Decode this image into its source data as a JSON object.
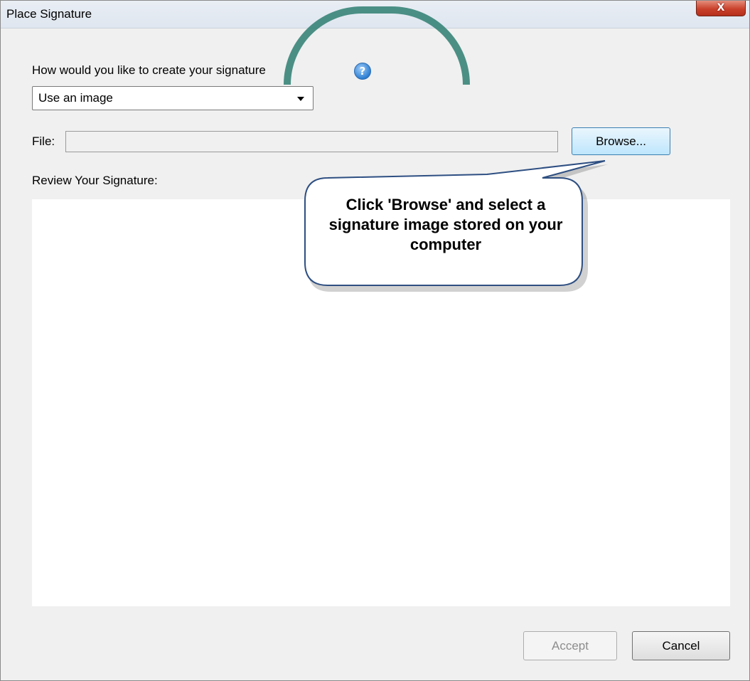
{
  "window": {
    "title": "Place Signature",
    "close_glyph": "X"
  },
  "form": {
    "method_label": "How would you like to create your signature",
    "help_glyph": "?",
    "method_value": "Use an image",
    "file_label": "File:",
    "file_value": "",
    "browse_label": "Browse...",
    "review_label": "Review Your Signature:"
  },
  "callout": {
    "text": "Click 'Browse' and select a signature image stored on your computer"
  },
  "footer": {
    "accept_label": "Accept",
    "cancel_label": "Cancel"
  },
  "colors": {
    "close_button": "#c9412b",
    "help_icon": "#2e7fd3",
    "callout_border": "#2e4f82",
    "title_arc": "#2f7f72"
  }
}
